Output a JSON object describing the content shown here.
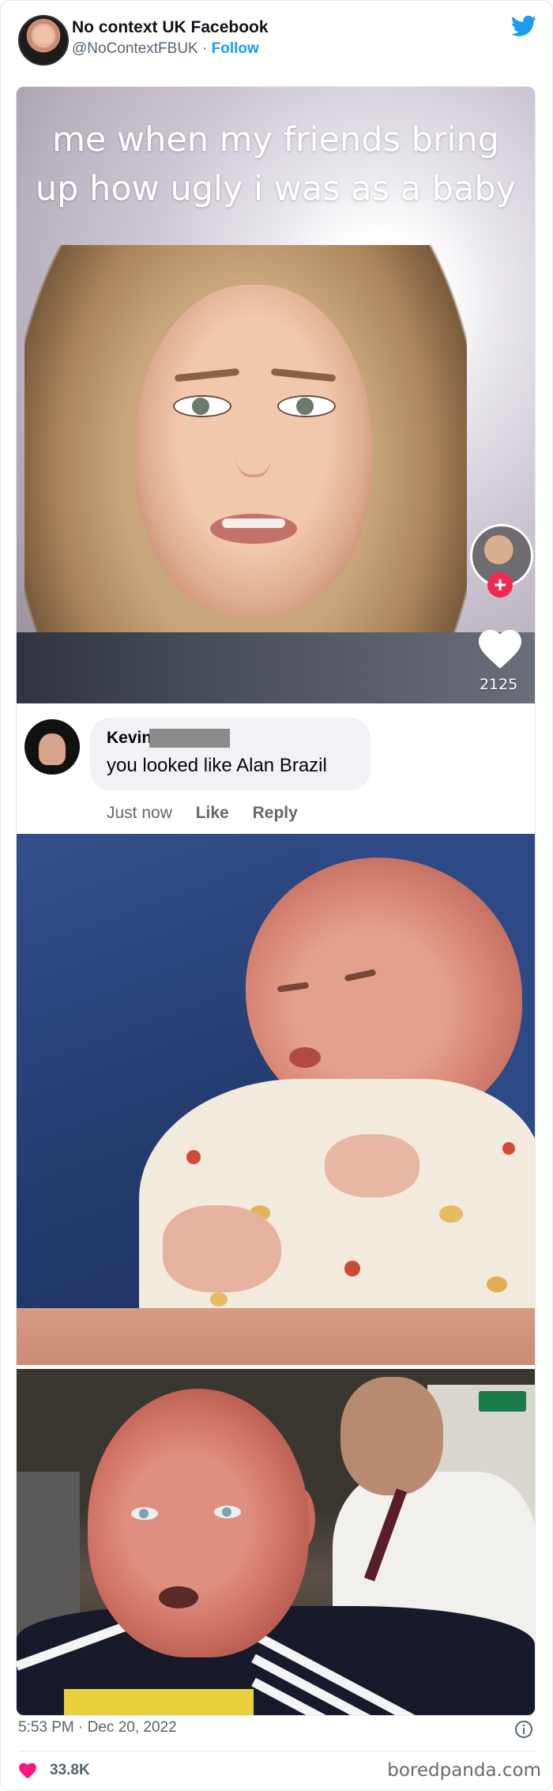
{
  "header": {
    "display_name": "No context UK Facebook",
    "handle": "@NoContextFBUK",
    "separator": "·",
    "follow_label": "Follow"
  },
  "tiktok": {
    "caption_line1": "me when my friends bring",
    "caption_line2": "up how ugly i was as a baby",
    "like_count": "2125",
    "follow_plus": "+"
  },
  "comment": {
    "author": "Kevin",
    "text": "you looked like Alan Brazil",
    "time": "Just now",
    "like_label": "Like",
    "reply_label": "Reply"
  },
  "footer": {
    "timestamp": "5:53 PM · Dec 20, 2022",
    "likes": "33.8K",
    "watermark": "boredpanda.com"
  },
  "icons": {
    "twitter": "twitter-bird-icon",
    "info": "info-icon",
    "like": "heart-icon",
    "tiktok_like": "heart-icon"
  },
  "colors": {
    "twitter_blue": "#1d9bf0",
    "like_pink": "#f91880",
    "tiktok_red": "#ef2950",
    "text_secondary": "#536471"
  }
}
